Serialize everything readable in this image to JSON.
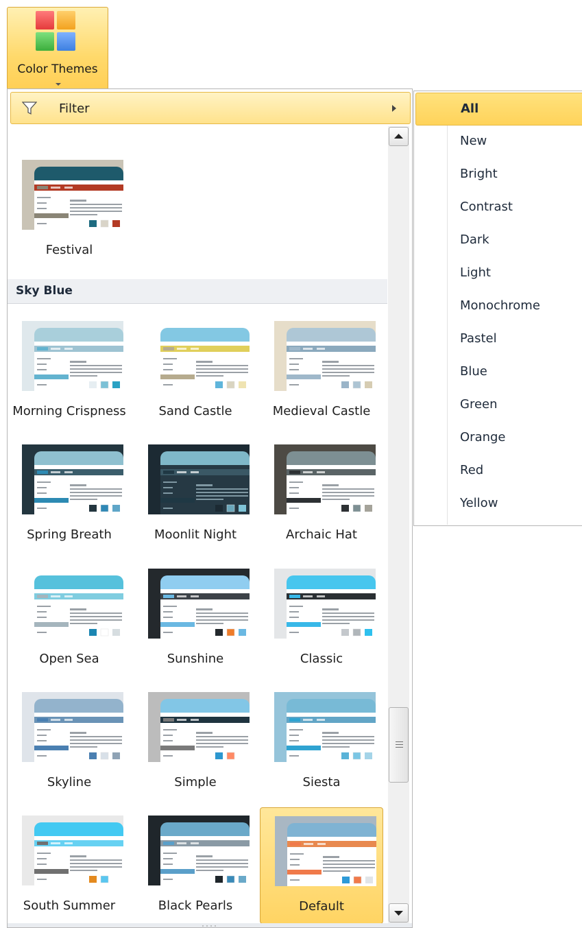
{
  "ribbon": {
    "label": "Color Themes",
    "icon": "color-themes-icon",
    "icon_colors": [
      "#ee4b4b",
      "#f7b13a",
      "#4fc04f",
      "#4a8be6"
    ]
  },
  "filter": {
    "label": "Filter",
    "icon": "filter-icon"
  },
  "gallery": {
    "top_theme": {
      "name": "Festival"
    },
    "section_title": "Sky Blue",
    "themes": [
      {
        "name": "Morning Crispness"
      },
      {
        "name": "Sand Castle"
      },
      {
        "name": "Medieval Castle"
      },
      {
        "name": "Spring Breath"
      },
      {
        "name": "Moonlit Night"
      },
      {
        "name": "Archaic Hat"
      },
      {
        "name": "Open Sea"
      },
      {
        "name": "Sunshine"
      },
      {
        "name": "Classic"
      },
      {
        "name": "Skyline"
      },
      {
        "name": "Simple"
      },
      {
        "name": "Siesta"
      },
      {
        "name": "South Summer"
      },
      {
        "name": "Black Pearls"
      },
      {
        "name": "Default"
      }
    ],
    "selected_theme": "Default"
  },
  "filter_menu": {
    "items": [
      "All",
      "New",
      "Bright",
      "Contrast",
      "Dark",
      "Light",
      "Monochrome",
      "Pastel",
      "Blue",
      "Green",
      "Orange",
      "Red",
      "Yellow"
    ],
    "selected": "All"
  },
  "colors": {
    "accent": "#ffd463",
    "accent_border": "#d9a73a"
  }
}
